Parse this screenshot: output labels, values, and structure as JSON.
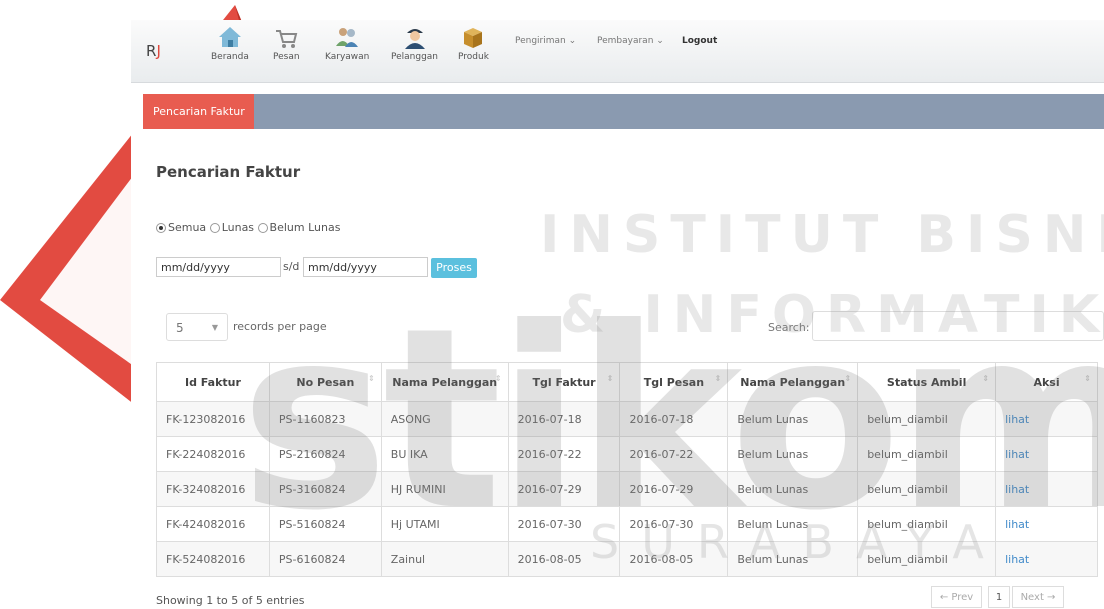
{
  "brand": {
    "r": "R",
    "j": "J"
  },
  "nav": [
    {
      "label": "Beranda",
      "icon": "home-icon"
    },
    {
      "label": "Pesan",
      "icon": "cart-icon"
    },
    {
      "label": "Karyawan",
      "icon": "users-icon"
    },
    {
      "label": "Pelanggan",
      "icon": "customer-icon"
    },
    {
      "label": "Produk",
      "icon": "box-icon"
    }
  ],
  "dropdowns": {
    "pengiriman": "Pengiriman ⌄",
    "pembayaran": "Pembayaran ⌄",
    "logout": "Logout"
  },
  "subtab": "Pencarian Faktur",
  "page_title": "Pencarian Faktur",
  "filters": {
    "semua": "Semua",
    "lunas": "Lunas",
    "belum_lunas": "Belum Lunas",
    "selected": "Semua"
  },
  "date_from": "mm/dd/yyyy",
  "date_sep": "s/d",
  "date_to": "mm/dd/yyyy",
  "proses_label": "Proses",
  "per_page": {
    "value": "5",
    "caret": "▼",
    "label": "records per page"
  },
  "search_label": "Search:",
  "table": {
    "headers": [
      "Id Faktur",
      "No Pesan",
      "Nama Pelanggan",
      "Tgl Faktur",
      "Tgl Pesan",
      "Nama Pelanggan",
      "Status Ambil",
      "Aksi"
    ],
    "rows": [
      [
        "FK-123082016",
        "PS-1160823",
        "ASONG",
        "2016-07-18",
        "2016-07-18",
        "Belum Lunas",
        "belum_diambil",
        "lihat"
      ],
      [
        "FK-224082016",
        "PS-2160824",
        "BU IKA",
        "2016-07-22",
        "2016-07-22",
        "Belum Lunas",
        "belum_diambil",
        "lihat"
      ],
      [
        "FK-324082016",
        "PS-3160824",
        "HJ RUMINI",
        "2016-07-29",
        "2016-07-29",
        "Belum Lunas",
        "belum_diambil",
        "lihat"
      ],
      [
        "FK-424082016",
        "PS-5160824",
        "Hj UTAMI",
        "2016-07-30",
        "2016-07-30",
        "Belum Lunas",
        "belum_diambil",
        "lihat"
      ],
      [
        "FK-524082016",
        "PS-6160824",
        "Zainul",
        "2016-08-05",
        "2016-08-05",
        "Belum Lunas",
        "belum_diambil",
        "lihat"
      ]
    ]
  },
  "info": "Showing 1 to 5 of 5 entries",
  "pager": {
    "prev": "← Prev",
    "page": "1",
    "next": "Next →"
  },
  "watermark": {
    "line1": "INSTITUT BISNIS",
    "line2": "& INFORMATIKA",
    "logo": "stikom",
    "city": "SURABAYA"
  },
  "colors": {
    "accent": "#e85c50",
    "subbar": "#8a9ab0",
    "button": "#5bc0de",
    "link": "#428bca"
  }
}
